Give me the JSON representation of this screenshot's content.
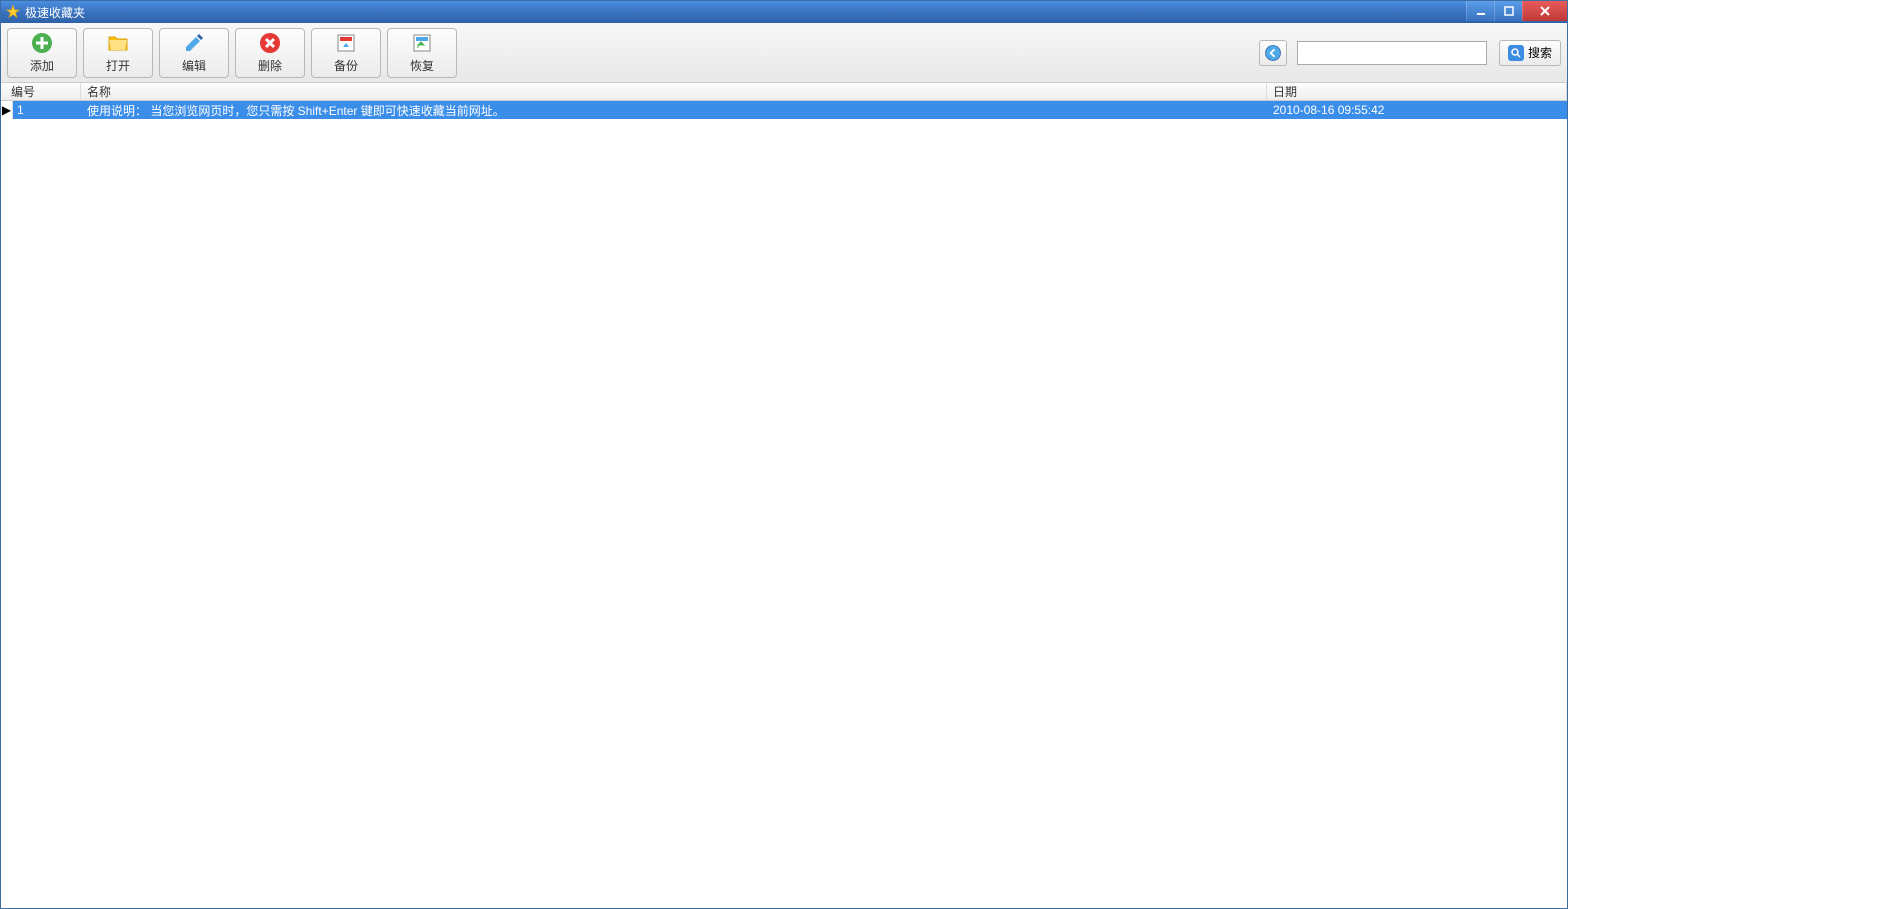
{
  "window": {
    "title": "极速收藏夹"
  },
  "toolbar": {
    "add_label": "添加",
    "open_label": "打开",
    "edit_label": "编辑",
    "delete_label": "删除",
    "backup_label": "备份",
    "restore_label": "恢复",
    "search_label": "搜索"
  },
  "search": {
    "value": ""
  },
  "table": {
    "columns": {
      "number": "编号",
      "name": "名称",
      "date": "日期"
    },
    "rows": [
      {
        "number": "1",
        "name": "使用说明：  当您浏览网页时，您只需按 Shift+Enter 键即可快速收藏当前网址。",
        "date": "2010-08-16 09:55:42"
      }
    ]
  }
}
